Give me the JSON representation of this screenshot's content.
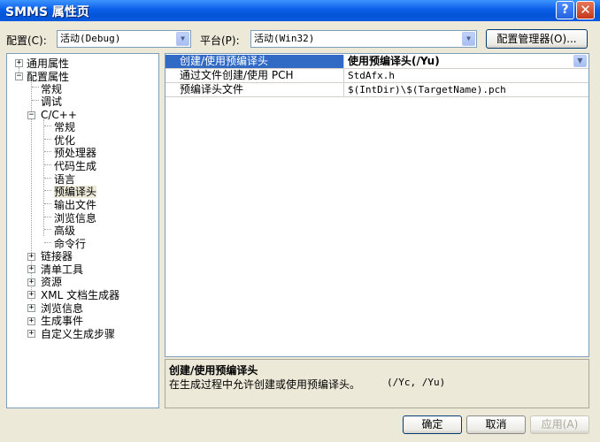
{
  "window": {
    "title": "SMMS 属性页",
    "help_label": "?",
    "close_label": "✕"
  },
  "config_bar": {
    "config_label": "配置(C):",
    "config_value": "活动(Debug)",
    "platform_label": "平台(P):",
    "platform_value": "活动(Win32)",
    "manager_button": "配置管理器(O)..."
  },
  "tree": {
    "items": [
      {
        "label": "通用属性",
        "expander": "+"
      },
      {
        "label": "配置属性",
        "expander": "−"
      },
      {
        "label": "常规"
      },
      {
        "label": "调试"
      },
      {
        "label": "C/C++",
        "expander": "−"
      },
      {
        "label": "常规"
      },
      {
        "label": "优化"
      },
      {
        "label": "预处理器"
      },
      {
        "label": "代码生成"
      },
      {
        "label": "语言"
      },
      {
        "label": "预编译头",
        "selected": true
      },
      {
        "label": "输出文件"
      },
      {
        "label": "浏览信息"
      },
      {
        "label": "高级"
      },
      {
        "label": "命令行"
      },
      {
        "label": "链接器",
        "expander": "+"
      },
      {
        "label": "清单工具",
        "expander": "+"
      },
      {
        "label": "资源",
        "expander": "+"
      },
      {
        "label": "XML 文档生成器",
        "expander": "+"
      },
      {
        "label": "浏览信息",
        "expander": "+"
      },
      {
        "label": "生成事件",
        "expander": "+"
      },
      {
        "label": "自定义生成步骤",
        "expander": "+"
      }
    ]
  },
  "grid": {
    "rows": [
      {
        "name": "创建/使用预编译头",
        "value": "使用预编译头(/Yu)"
      },
      {
        "name": "通过文件创建/使用 PCH",
        "value": "StdAfx.h"
      },
      {
        "name": "预编译头文件",
        "value": "$(IntDir)\\$(TargetName).pch"
      }
    ]
  },
  "description": {
    "title": "创建/使用预编译头",
    "text": "在生成过程中允许创建或使用预编译头。",
    "flags": "(/Yc, /Yu)"
  },
  "buttons": {
    "ok": "确定",
    "cancel": "取消",
    "apply": "应用(A)"
  }
}
